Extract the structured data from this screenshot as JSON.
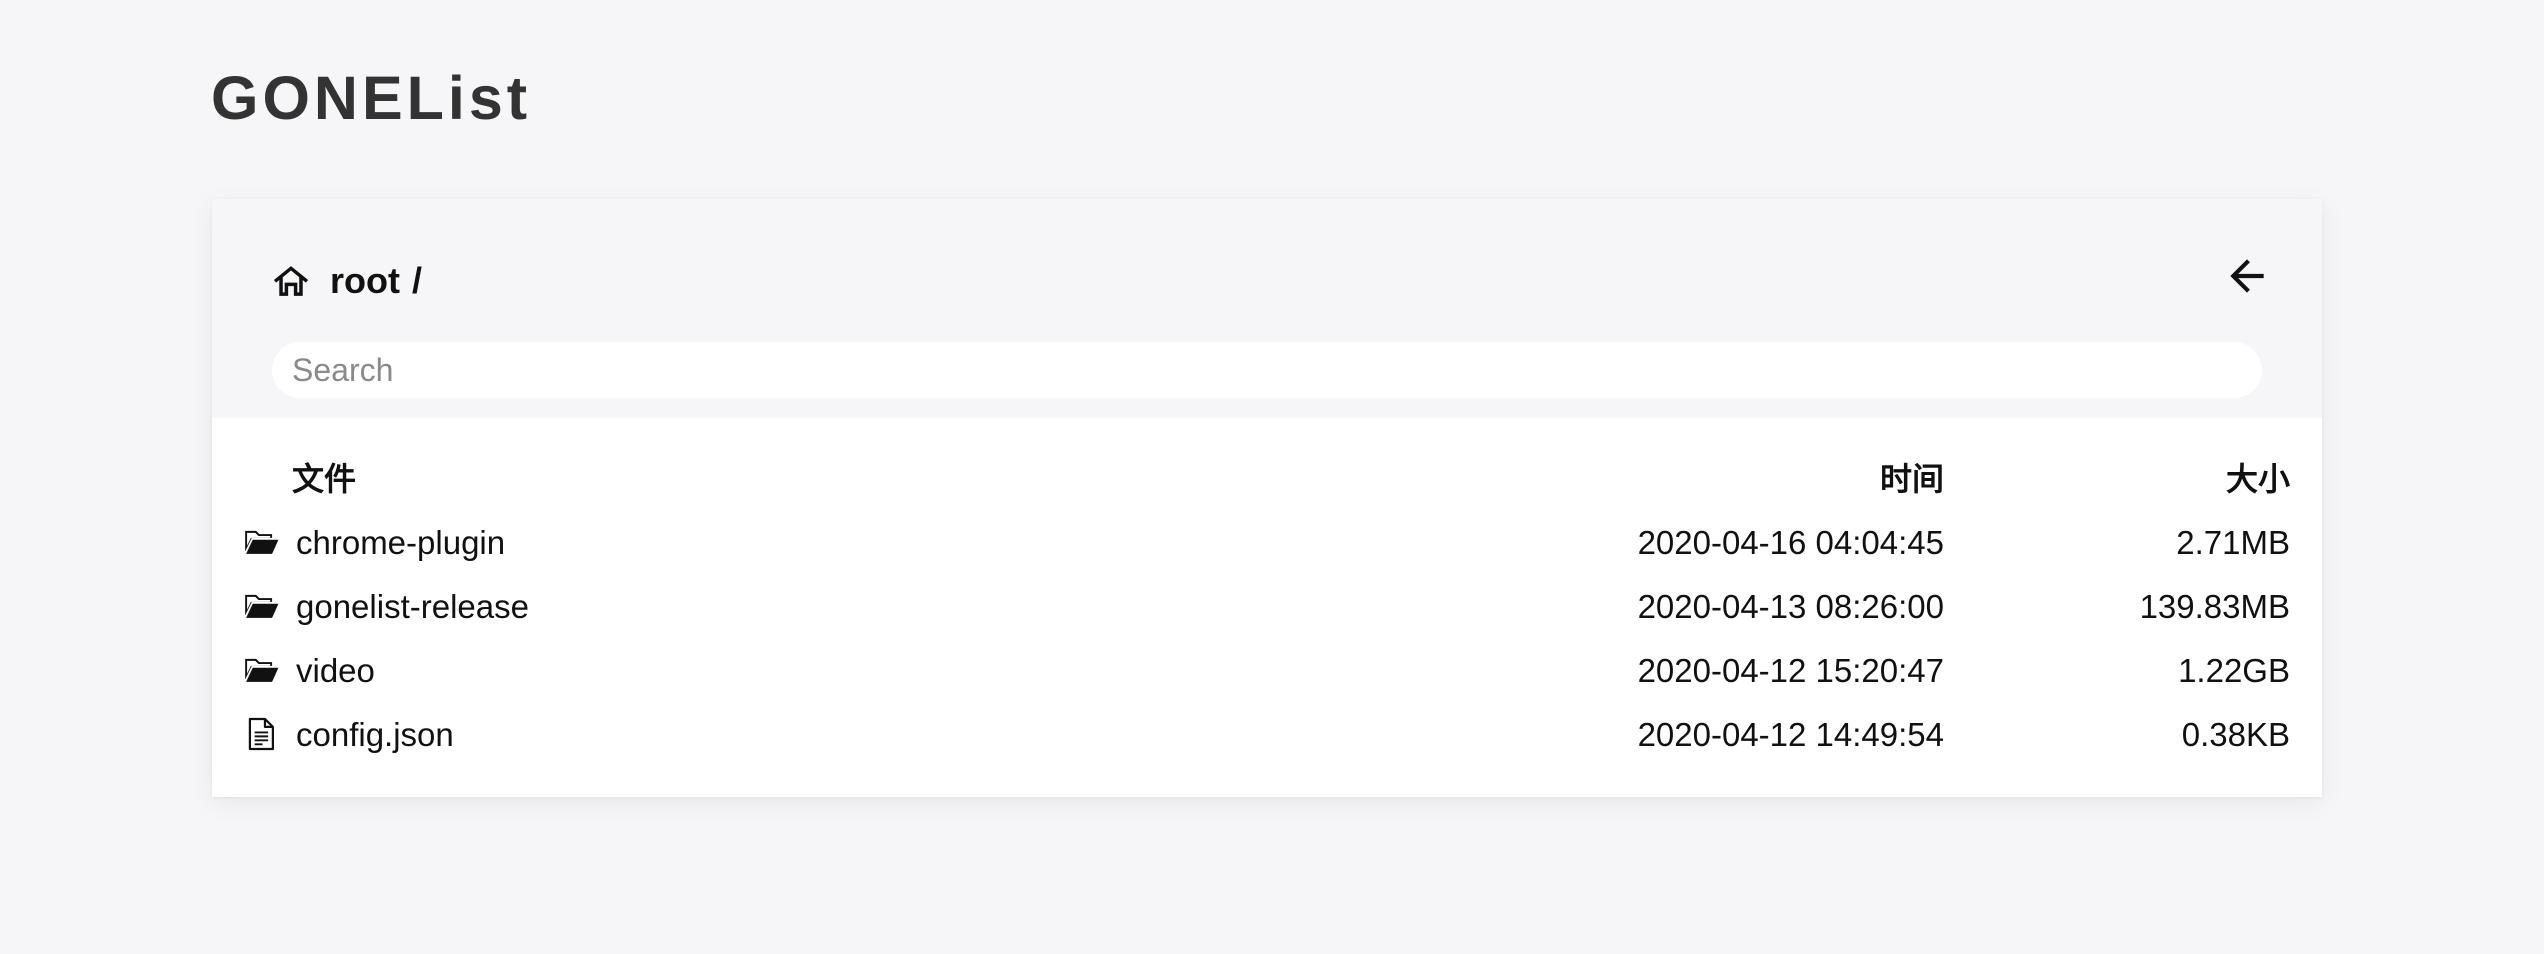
{
  "app": {
    "title": "GONEList"
  },
  "breadcrumb": {
    "icon": "home-icon",
    "root_label": "root",
    "separator": "/"
  },
  "header": {
    "back_icon": "arrow-left-icon"
  },
  "search": {
    "placeholder": "Search",
    "value": ""
  },
  "table": {
    "columns": {
      "name": "文件",
      "time": "时间",
      "size": "大小"
    },
    "rows": [
      {
        "icon": "folder-icon",
        "name": "chrome-plugin",
        "time": "2020-04-16 04:04:45",
        "size": "2.71MB"
      },
      {
        "icon": "folder-icon",
        "name": "gonelist-release",
        "time": "2020-04-13 08:26:00",
        "size": "139.83MB"
      },
      {
        "icon": "folder-icon",
        "name": "video",
        "time": "2020-04-12 15:20:47",
        "size": "1.22GB"
      },
      {
        "icon": "file-icon",
        "name": "config.json",
        "time": "2020-04-12 14:49:54",
        "size": "0.38KB"
      }
    ]
  },
  "colors": {
    "page_background": "#f6f6f8",
    "card_background": "#ffffff",
    "header_background": "#f6f6f8",
    "title_text": "#333333",
    "body_text": "#111111"
  }
}
